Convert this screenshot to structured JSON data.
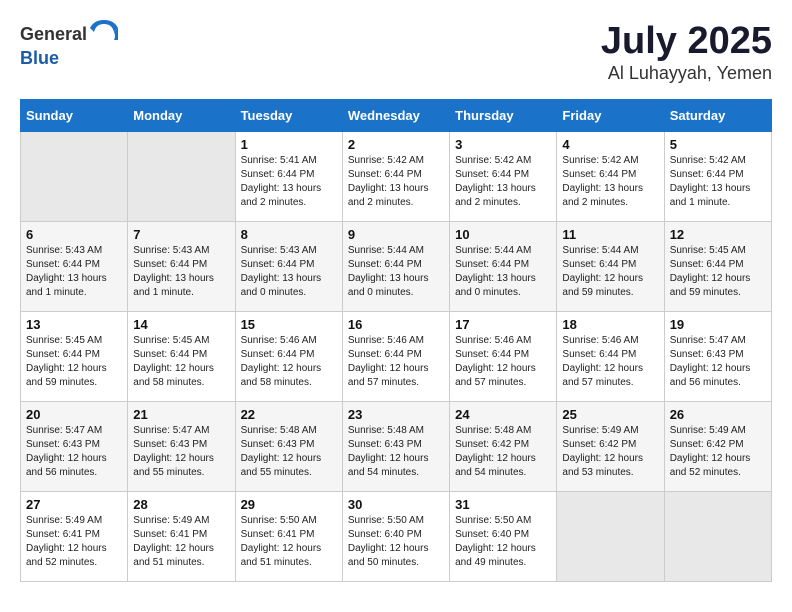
{
  "header": {
    "logo_general": "General",
    "logo_blue": "Blue",
    "month": "July 2025",
    "location": "Al Luhayyah, Yemen"
  },
  "days_of_week": [
    "Sunday",
    "Monday",
    "Tuesday",
    "Wednesday",
    "Thursday",
    "Friday",
    "Saturday"
  ],
  "weeks": [
    [
      {
        "day": "",
        "empty": true
      },
      {
        "day": "",
        "empty": true
      },
      {
        "day": "1",
        "sunrise": "Sunrise: 5:41 AM",
        "sunset": "Sunset: 6:44 PM",
        "daylight": "Daylight: 13 hours and 2 minutes."
      },
      {
        "day": "2",
        "sunrise": "Sunrise: 5:42 AM",
        "sunset": "Sunset: 6:44 PM",
        "daylight": "Daylight: 13 hours and 2 minutes."
      },
      {
        "day": "3",
        "sunrise": "Sunrise: 5:42 AM",
        "sunset": "Sunset: 6:44 PM",
        "daylight": "Daylight: 13 hours and 2 minutes."
      },
      {
        "day": "4",
        "sunrise": "Sunrise: 5:42 AM",
        "sunset": "Sunset: 6:44 PM",
        "daylight": "Daylight: 13 hours and 2 minutes."
      },
      {
        "day": "5",
        "sunrise": "Sunrise: 5:42 AM",
        "sunset": "Sunset: 6:44 PM",
        "daylight": "Daylight: 13 hours and 1 minute."
      }
    ],
    [
      {
        "day": "6",
        "sunrise": "Sunrise: 5:43 AM",
        "sunset": "Sunset: 6:44 PM",
        "daylight": "Daylight: 13 hours and 1 minute."
      },
      {
        "day": "7",
        "sunrise": "Sunrise: 5:43 AM",
        "sunset": "Sunset: 6:44 PM",
        "daylight": "Daylight: 13 hours and 1 minute."
      },
      {
        "day": "8",
        "sunrise": "Sunrise: 5:43 AM",
        "sunset": "Sunset: 6:44 PM",
        "daylight": "Daylight: 13 hours and 0 minutes."
      },
      {
        "day": "9",
        "sunrise": "Sunrise: 5:44 AM",
        "sunset": "Sunset: 6:44 PM",
        "daylight": "Daylight: 13 hours and 0 minutes."
      },
      {
        "day": "10",
        "sunrise": "Sunrise: 5:44 AM",
        "sunset": "Sunset: 6:44 PM",
        "daylight": "Daylight: 13 hours and 0 minutes."
      },
      {
        "day": "11",
        "sunrise": "Sunrise: 5:44 AM",
        "sunset": "Sunset: 6:44 PM",
        "daylight": "Daylight: 12 hours and 59 minutes."
      },
      {
        "day": "12",
        "sunrise": "Sunrise: 5:45 AM",
        "sunset": "Sunset: 6:44 PM",
        "daylight": "Daylight: 12 hours and 59 minutes."
      }
    ],
    [
      {
        "day": "13",
        "sunrise": "Sunrise: 5:45 AM",
        "sunset": "Sunset: 6:44 PM",
        "daylight": "Daylight: 12 hours and 59 minutes."
      },
      {
        "day": "14",
        "sunrise": "Sunrise: 5:45 AM",
        "sunset": "Sunset: 6:44 PM",
        "daylight": "Daylight: 12 hours and 58 minutes."
      },
      {
        "day": "15",
        "sunrise": "Sunrise: 5:46 AM",
        "sunset": "Sunset: 6:44 PM",
        "daylight": "Daylight: 12 hours and 58 minutes."
      },
      {
        "day": "16",
        "sunrise": "Sunrise: 5:46 AM",
        "sunset": "Sunset: 6:44 PM",
        "daylight": "Daylight: 12 hours and 57 minutes."
      },
      {
        "day": "17",
        "sunrise": "Sunrise: 5:46 AM",
        "sunset": "Sunset: 6:44 PM",
        "daylight": "Daylight: 12 hours and 57 minutes."
      },
      {
        "day": "18",
        "sunrise": "Sunrise: 5:46 AM",
        "sunset": "Sunset: 6:44 PM",
        "daylight": "Daylight: 12 hours and 57 minutes."
      },
      {
        "day": "19",
        "sunrise": "Sunrise: 5:47 AM",
        "sunset": "Sunset: 6:43 PM",
        "daylight": "Daylight: 12 hours and 56 minutes."
      }
    ],
    [
      {
        "day": "20",
        "sunrise": "Sunrise: 5:47 AM",
        "sunset": "Sunset: 6:43 PM",
        "daylight": "Daylight: 12 hours and 56 minutes."
      },
      {
        "day": "21",
        "sunrise": "Sunrise: 5:47 AM",
        "sunset": "Sunset: 6:43 PM",
        "daylight": "Daylight: 12 hours and 55 minutes."
      },
      {
        "day": "22",
        "sunrise": "Sunrise: 5:48 AM",
        "sunset": "Sunset: 6:43 PM",
        "daylight": "Daylight: 12 hours and 55 minutes."
      },
      {
        "day": "23",
        "sunrise": "Sunrise: 5:48 AM",
        "sunset": "Sunset: 6:43 PM",
        "daylight": "Daylight: 12 hours and 54 minutes."
      },
      {
        "day": "24",
        "sunrise": "Sunrise: 5:48 AM",
        "sunset": "Sunset: 6:42 PM",
        "daylight": "Daylight: 12 hours and 54 minutes."
      },
      {
        "day": "25",
        "sunrise": "Sunrise: 5:49 AM",
        "sunset": "Sunset: 6:42 PM",
        "daylight": "Daylight: 12 hours and 53 minutes."
      },
      {
        "day": "26",
        "sunrise": "Sunrise: 5:49 AM",
        "sunset": "Sunset: 6:42 PM",
        "daylight": "Daylight: 12 hours and 52 minutes."
      }
    ],
    [
      {
        "day": "27",
        "sunrise": "Sunrise: 5:49 AM",
        "sunset": "Sunset: 6:41 PM",
        "daylight": "Daylight: 12 hours and 52 minutes."
      },
      {
        "day": "28",
        "sunrise": "Sunrise: 5:49 AM",
        "sunset": "Sunset: 6:41 PM",
        "daylight": "Daylight: 12 hours and 51 minutes."
      },
      {
        "day": "29",
        "sunrise": "Sunrise: 5:50 AM",
        "sunset": "Sunset: 6:41 PM",
        "daylight": "Daylight: 12 hours and 51 minutes."
      },
      {
        "day": "30",
        "sunrise": "Sunrise: 5:50 AM",
        "sunset": "Sunset: 6:40 PM",
        "daylight": "Daylight: 12 hours and 50 minutes."
      },
      {
        "day": "31",
        "sunrise": "Sunrise: 5:50 AM",
        "sunset": "Sunset: 6:40 PM",
        "daylight": "Daylight: 12 hours and 49 minutes."
      },
      {
        "day": "",
        "empty": true
      },
      {
        "day": "",
        "empty": true
      }
    ]
  ]
}
